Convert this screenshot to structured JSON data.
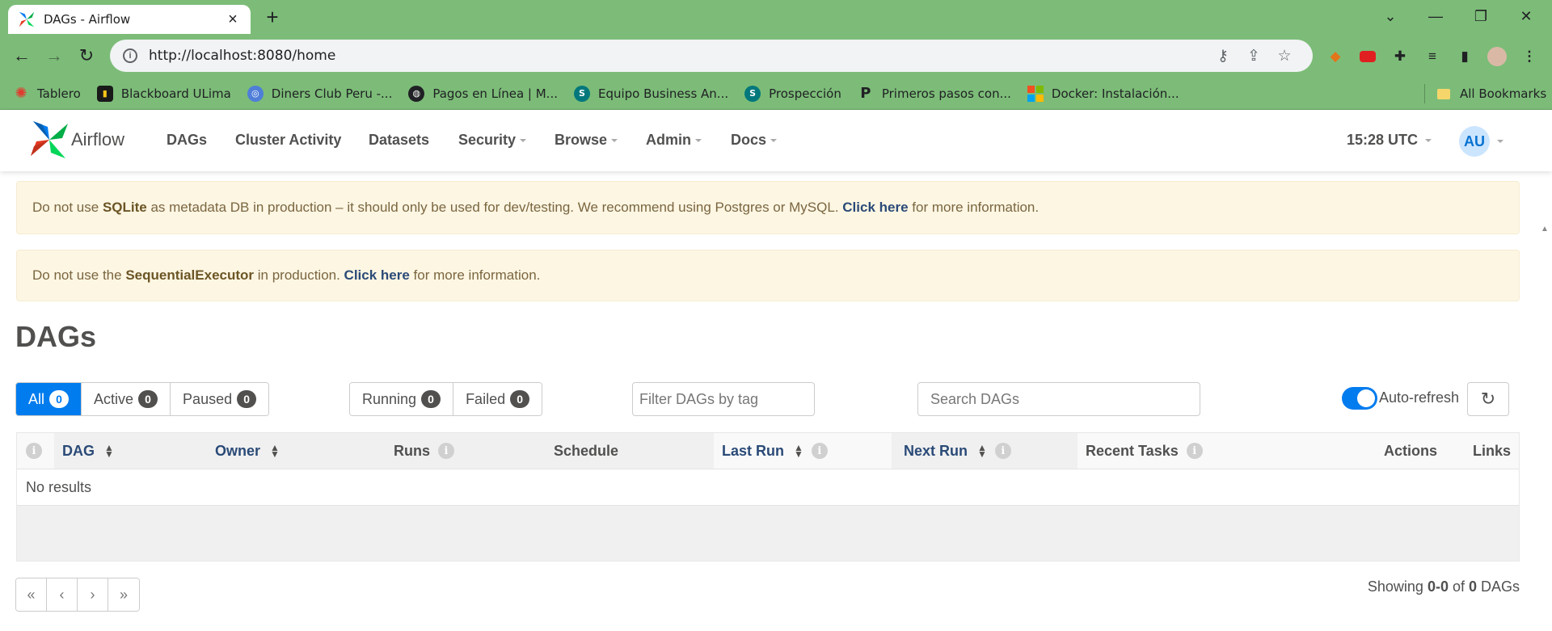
{
  "browser": {
    "tab_title": "DAGs - Airflow",
    "url": "http://localhost:8080/home",
    "bookmarks": [
      {
        "label": "Tablero",
        "icon": "canvas-icon",
        "color": "#e13b2e"
      },
      {
        "label": "Blackboard ULima",
        "icon": "blackboard-icon",
        "color": "#1a1a1a"
      },
      {
        "label": "Diners Club Peru -...",
        "icon": "diners-icon",
        "color": "#4f7ed8"
      },
      {
        "label": "Pagos en Línea | M...",
        "icon": "globe-icon",
        "color": "#202124"
      },
      {
        "label": "Equipo Business An...",
        "icon": "sharepoint-icon",
        "color": "#03787c"
      },
      {
        "label": "Prospección",
        "icon": "sharepoint-icon",
        "color": "#03787c"
      },
      {
        "label": "Primeros pasos con...",
        "icon": "pentaho-icon",
        "color": "#202124"
      },
      {
        "label": "Docker: Instalación...",
        "icon": "microsoft-icon",
        "color": "#f25022"
      }
    ],
    "all_bookmarks": "All Bookmarks"
  },
  "nav": {
    "brand": "Airflow",
    "menu": [
      {
        "label": "DAGs",
        "dropdown": false
      },
      {
        "label": "Cluster Activity",
        "dropdown": false
      },
      {
        "label": "Datasets",
        "dropdown": false
      },
      {
        "label": "Security",
        "dropdown": true
      },
      {
        "label": "Browse",
        "dropdown": true
      },
      {
        "label": "Admin",
        "dropdown": true
      },
      {
        "label": "Docs",
        "dropdown": true
      }
    ],
    "time": "15:28 UTC",
    "user_initials": "AU"
  },
  "alerts": [
    {
      "pre": "Do not use ",
      "keyword": "SQLite",
      "mid": " as metadata DB in production – it should only be used for dev/testing. We recommend using Postgres or MySQL. ",
      "link": "Click here",
      "post": " for more information."
    },
    {
      "pre": "Do not use the ",
      "keyword": "SequentialExecutor",
      "mid": " in production. ",
      "link": "Click here",
      "post": " for more information."
    }
  ],
  "page": {
    "title": "DAGs",
    "status_filters": [
      {
        "label": "All",
        "count": "0",
        "active": true
      },
      {
        "label": "Active",
        "count": "0",
        "active": false
      },
      {
        "label": "Paused",
        "count": "0",
        "active": false
      }
    ],
    "run_filters": [
      {
        "label": "Running",
        "count": "0"
      },
      {
        "label": "Failed",
        "count": "0"
      }
    ],
    "tag_filter_placeholder": "Filter DAGs by tag",
    "search_placeholder": "Search DAGs",
    "auto_refresh_label": "Auto-refresh",
    "auto_refresh_on": true
  },
  "table": {
    "columns": [
      {
        "label": "DAG",
        "sortable": true,
        "info": false
      },
      {
        "label": "Owner",
        "sortable": true,
        "info": false
      },
      {
        "label": "Runs",
        "sortable": false,
        "info": true
      },
      {
        "label": "Schedule",
        "sortable": false,
        "info": false
      },
      {
        "label": "Last Run",
        "sortable": true,
        "info": true
      },
      {
        "label": "Next Run",
        "sortable": true,
        "info": true
      },
      {
        "label": "Recent Tasks",
        "sortable": false,
        "info": true
      },
      {
        "label": "Actions",
        "sortable": false,
        "info": false
      },
      {
        "label": "Links",
        "sortable": false,
        "info": false
      }
    ],
    "empty_message": "No results"
  },
  "pagination": {
    "buttons": [
      "«",
      "‹",
      "›",
      "»"
    ],
    "showing_pre": "Showing ",
    "showing_range": "0-0",
    "showing_mid": " of ",
    "showing_total": "0",
    "showing_post": " DAGs"
  },
  "colors": {
    "chrome_green": "#7cbc78",
    "airflow_blue": "#017cee",
    "alert_bg": "#fdf6e3",
    "link": "#2a4a77"
  }
}
